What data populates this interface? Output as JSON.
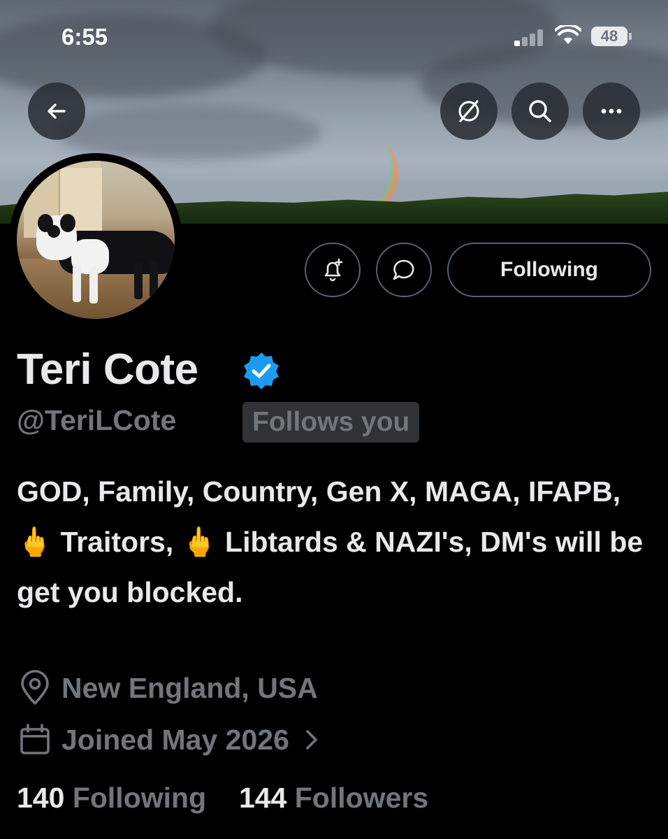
{
  "status_bar": {
    "time": "6:55",
    "battery": "48"
  },
  "header": {
    "back_icon": "arrow-left-icon",
    "grok_icon": "grok-icon",
    "search_icon": "search-icon",
    "more_icon": "more-horizontal-icon"
  },
  "actions": {
    "notify_icon": "bell-plus-icon",
    "message_icon": "message-bubble-icon",
    "following_label": "Following"
  },
  "profile": {
    "name": "Teri Cote",
    "verified_color": "#1d9bf0",
    "handle": "@TeriLCote",
    "follows_you": "Follows you",
    "bio": "GOD, Family, Country, Gen X, MAGA, IFAPB, 🖕 Traitors, 🖕 Libtards & NAZI's, DM's will be get you blocked.",
    "location": "New England, USA",
    "joined": "Joined May 2026",
    "following_count": "140",
    "following_label": "Following",
    "followers_count": "144",
    "followers_label": "Followers"
  },
  "colors": {
    "background": "#000000",
    "text_primary": "#e7e9ea",
    "text_secondary": "#71767b",
    "border": "#536471"
  }
}
